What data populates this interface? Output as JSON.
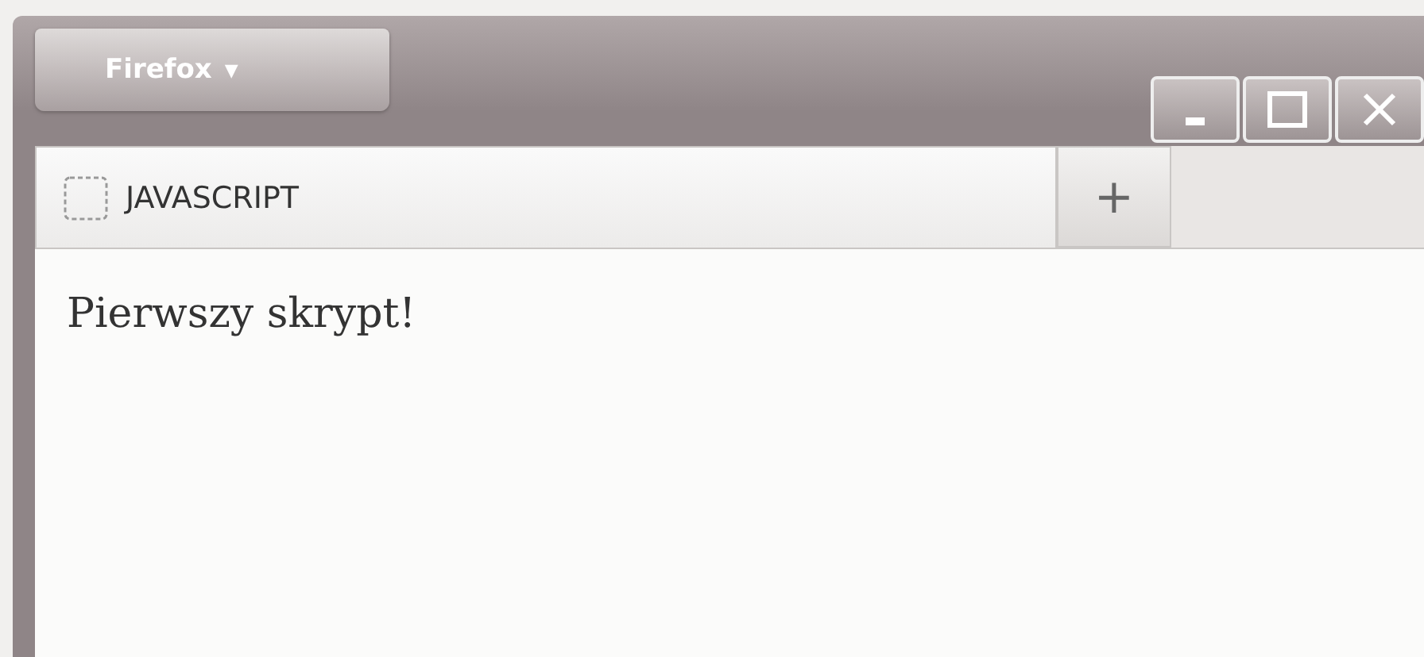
{
  "app_button": {
    "label": "Firefox",
    "caret": "▼"
  },
  "tabs": [
    {
      "label": "JAVASCRIPT",
      "selected": true
    }
  ],
  "new_tab": "+",
  "content": {
    "text": "Pierwszy skrypt!"
  }
}
